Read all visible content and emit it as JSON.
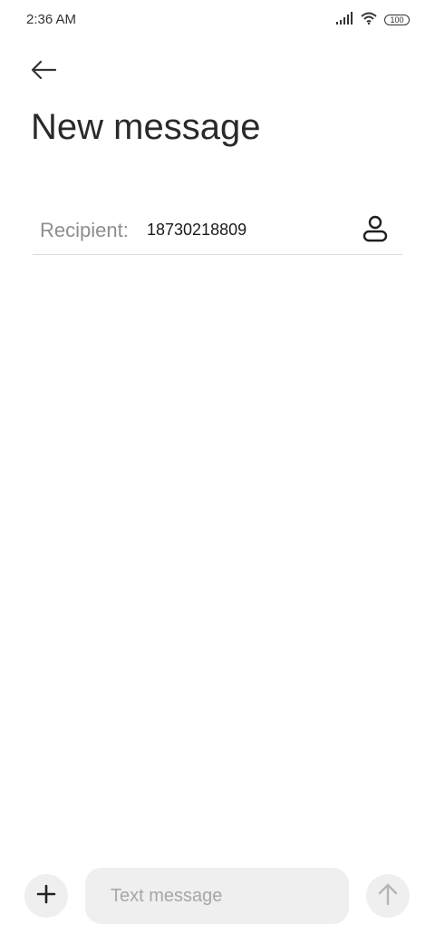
{
  "status_bar": {
    "time": "2:36 AM",
    "icons": [
      "signal-icon",
      "wifi-icon",
      "battery-icon"
    ],
    "battery_level": "100"
  },
  "header": {
    "back_icon": "arrow-left-icon",
    "title": "New message"
  },
  "recipient": {
    "label": "Recipient:",
    "value": "18730218809",
    "contact_icon": "person-icon"
  },
  "composer": {
    "add_icon": "plus-icon",
    "placeholder": "Text message",
    "send_icon": "arrow-up-icon"
  },
  "colors": {
    "background": "#ffffff",
    "input_background": "#efefef",
    "label_gray": "#8e8e8e",
    "text": "#1a1a1a"
  }
}
